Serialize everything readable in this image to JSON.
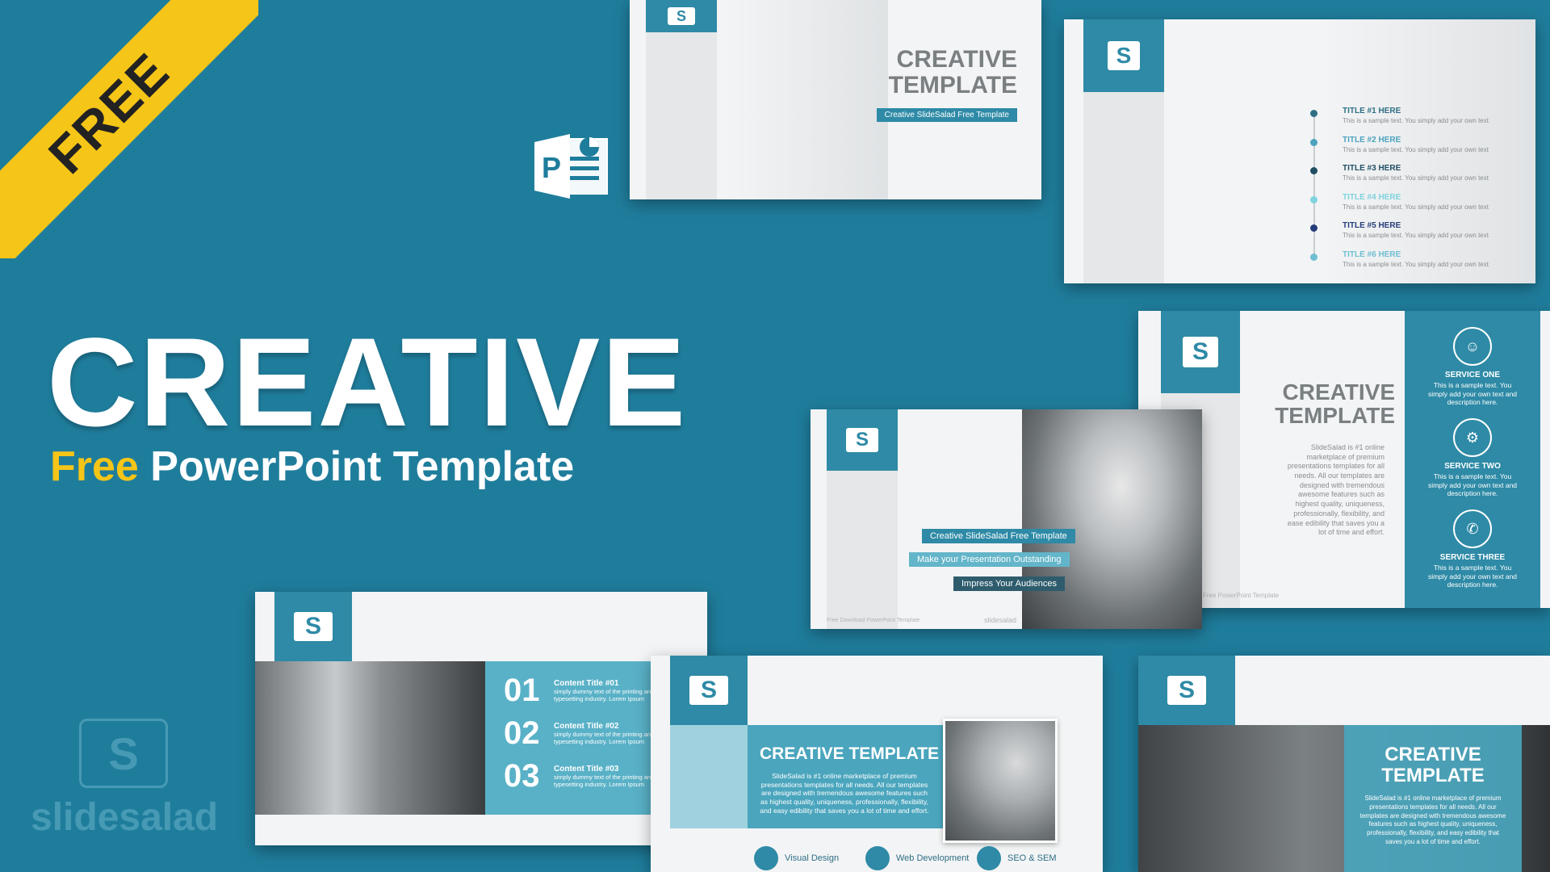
{
  "ribbon": {
    "label": "FREE"
  },
  "headline": {
    "title": "CREATIVE",
    "sub_highlight": "Free",
    "sub_rest": " PowerPoint Template"
  },
  "ppt_icon": {
    "letter": "P"
  },
  "slide_logo_letter": "S",
  "slide1": {
    "title_line1": "CREATIVE",
    "title_line2": "TEMPLATE",
    "tag": "Creative SlideSalad Free Template"
  },
  "slide2": {
    "items": [
      {
        "title": "TITLE #1 HERE",
        "desc": "This is a sample text. You simply add your own text",
        "color": "#2e6f86"
      },
      {
        "title": "TITLE #2 HERE",
        "desc": "This is a sample text. You simply add your own text",
        "color": "#4ba3bf"
      },
      {
        "title": "TITLE #3 HERE",
        "desc": "This is a sample text. You simply add your own text",
        "color": "#1f4f63"
      },
      {
        "title": "TITLE #4 HERE",
        "desc": "This is a sample text. You simply add your own text",
        "color": "#7fd3df"
      },
      {
        "title": "TITLE #5 HERE",
        "desc": "This is a sample text. You simply add your own text",
        "color": "#243d7a"
      },
      {
        "title": "TITLE #6 HERE",
        "desc": "This is a sample text. You simply add your own text",
        "color": "#6fbfd2"
      }
    ]
  },
  "slide3": {
    "title_line1": "CREATIVE",
    "title_line2": "TEMPLATE",
    "body": "SlideSalad is #1 online marketplace of premium presentations templates for all needs. All our templates are designed with tremendous awesome features such as highest quality, uniqueness, professionally, flexibility, and ease edibility that saves you a lot of time and effort.",
    "footer": "Free PowerPoint Template",
    "services": [
      {
        "icon": "person-icon",
        "glyph": "☺",
        "title": "SERVICE ONE",
        "desc": "This is a sample text. You simply add your own text and description here."
      },
      {
        "icon": "gear-icon",
        "glyph": "⚙",
        "title": "SERVICE TWO",
        "desc": "This is a sample text. You simply add your own text and description here."
      },
      {
        "icon": "megaphone-icon",
        "glyph": "✆",
        "title": "SERVICE THREE",
        "desc": "This is a sample text. You simply add your own text and description here."
      }
    ]
  },
  "slide4": {
    "tags": [
      "Creative SlideSalad Free Template",
      "Make your Presentation Outstanding",
      "Impress Your Audiences"
    ],
    "footer_left": "Free Download PowerPoint Template",
    "footer_right": "slidesalad"
  },
  "slide5": {
    "rows": [
      {
        "num": "01",
        "title": "Content Title #01",
        "desc": "simply dummy text of the printing and typesetting industry. Lorem Ipsum"
      },
      {
        "num": "02",
        "title": "Content Title #02",
        "desc": "simply dummy text of the printing and typesetting industry. Lorem Ipsum"
      },
      {
        "num": "03",
        "title": "Content Title #03",
        "desc": "simply dummy text of the printing and typesetting industry. Lorem Ipsum"
      }
    ]
  },
  "slide6": {
    "title": "CREATIVE TEMPLATE",
    "body": "SlideSalad is #1 online marketplace of premium presentations templates for all needs. All our templates are designed with tremendous awesome features such as highest quality, uniqueness, professionally, flexibility, and easy edibility that saves you a lot of time and effort.",
    "features": [
      "Visual Design",
      "Web Development",
      "SEO & SEM"
    ]
  },
  "slide7": {
    "title_line1": "CREATIVE",
    "title_line2": "TEMPLATE",
    "body": "SlideSalad is #1 online marketplace of premium presentations templates for all needs. All our templates are designed with tremendous awesome features such as highest quality, uniqueness, professionally, flexibility, and easy edibility that saves you a lot of time and effort."
  },
  "brand": {
    "letter": "S",
    "name": "slidesalad"
  },
  "colors": {
    "background": "#1f7d9c",
    "accent": "#2e8aa6",
    "ribbon": "#f5c518"
  }
}
